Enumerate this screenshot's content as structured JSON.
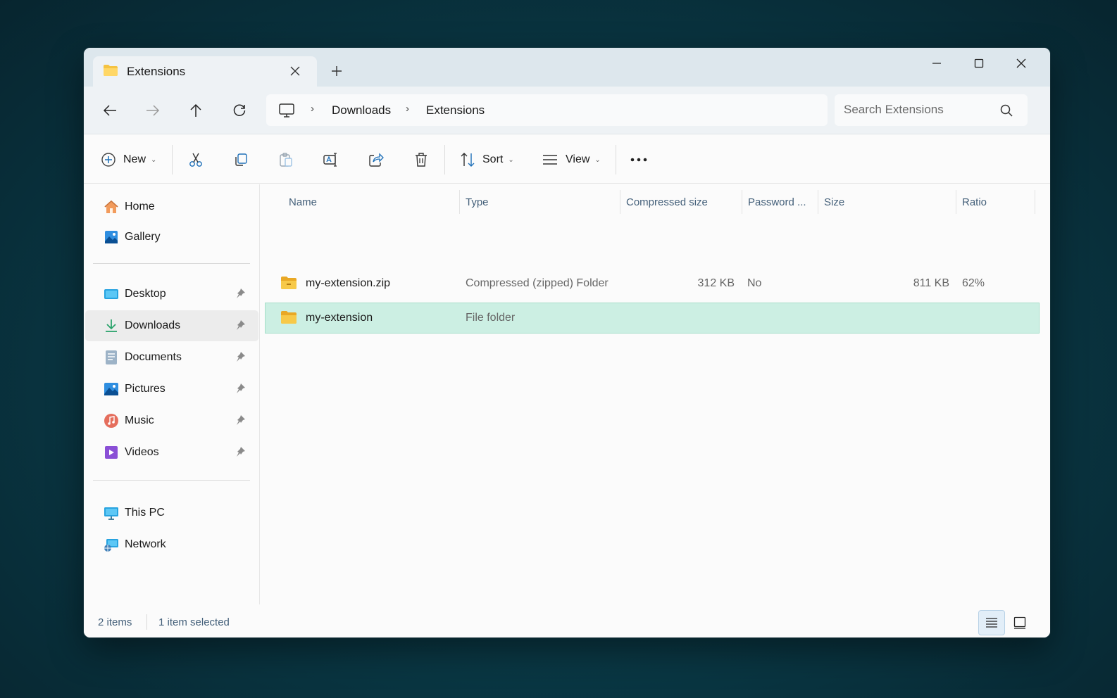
{
  "tab": {
    "title": "Extensions",
    "close_icon": "close-icon",
    "new_tab_icon": "plus-icon"
  },
  "window_controls": {
    "minimize": "minimize-icon",
    "maximize": "maximize-icon",
    "close": "close-icon"
  },
  "navigation": {
    "back": "arrow-left-icon",
    "forward": "arrow-right-icon",
    "up": "arrow-up-icon",
    "refresh": "refresh-icon"
  },
  "breadcrumb": {
    "items": [
      "Downloads",
      "Extensions"
    ],
    "root_icon": "this-pc-icon",
    "separator": "›"
  },
  "search": {
    "placeholder": "Search Extensions"
  },
  "toolbar": {
    "new_label": "New",
    "sort_label": "Sort",
    "view_label": "View",
    "icons": [
      "cut-icon",
      "copy-icon",
      "paste-icon",
      "rename-icon",
      "share-icon",
      "delete-icon",
      "more-icon"
    ]
  },
  "sidebar": {
    "items": [
      {
        "label": "Home",
        "icon": "home-icon",
        "pinned": false
      },
      {
        "label": "Gallery",
        "icon": "gallery-icon",
        "pinned": false
      },
      {
        "label": "Desktop",
        "icon": "desktop-icon",
        "pinned": true
      },
      {
        "label": "Downloads",
        "icon": "downloads-icon",
        "pinned": true,
        "selected": true
      },
      {
        "label": "Documents",
        "icon": "documents-icon",
        "pinned": true
      },
      {
        "label": "Pictures",
        "icon": "pictures-icon",
        "pinned": true
      },
      {
        "label": "Music",
        "icon": "music-icon",
        "pinned": true
      },
      {
        "label": "Videos",
        "icon": "videos-icon",
        "pinned": true
      },
      {
        "label": "This PC",
        "icon": "this-pc-icon",
        "pinned": false
      },
      {
        "label": "Network",
        "icon": "network-icon",
        "pinned": false
      }
    ]
  },
  "files": {
    "columns": [
      "Name",
      "Type",
      "Compressed size",
      "Password ...",
      "Size",
      "Ratio"
    ],
    "rows": [
      {
        "name": "my-extension.zip",
        "type": "Compressed (zipped) Folder",
        "compressed_size": "312 KB",
        "password": "No",
        "size": "811 KB",
        "ratio": "62%",
        "selected": false
      },
      {
        "name": "my-extension",
        "type": "File folder",
        "compressed_size": "",
        "password": "",
        "size": "",
        "ratio": "",
        "selected": true
      }
    ]
  },
  "status": {
    "item_count": "2 items",
    "selection": "1 item selected"
  },
  "colors": {
    "selection": "#ccefe3",
    "folder": "#f5c342",
    "accent": "#1d6fb8",
    "background": "#0a3a47"
  }
}
